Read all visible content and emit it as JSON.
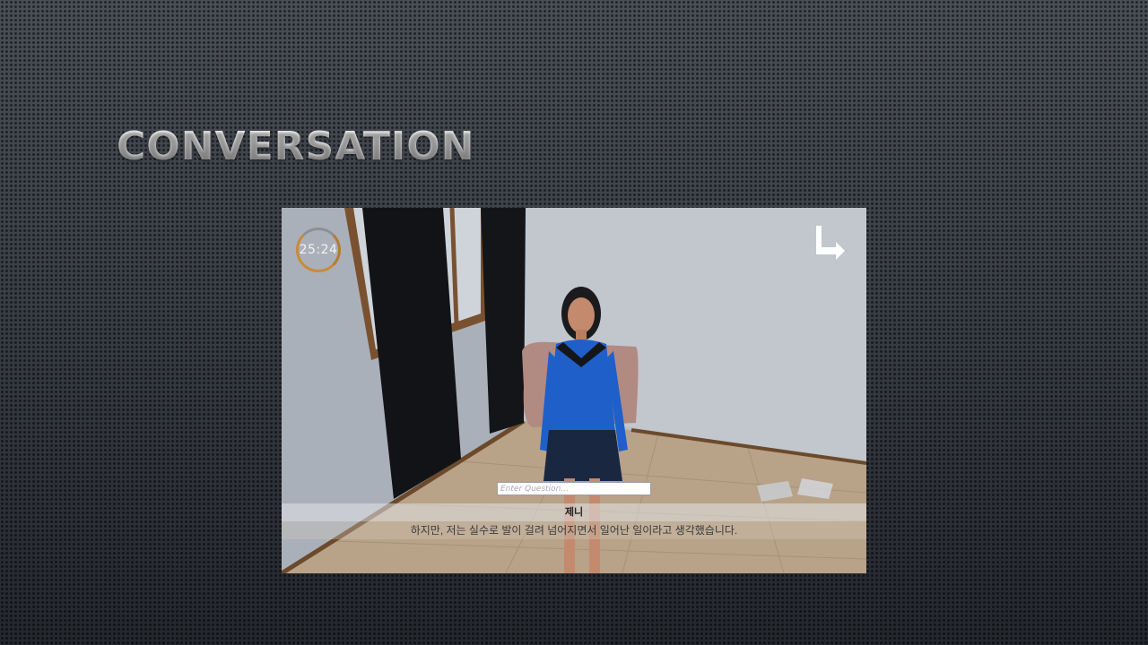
{
  "slide": {
    "title": "CONVERSATION"
  },
  "game": {
    "timer": "25:24",
    "exit_icon": "exit-arrow-icon",
    "question_placeholder": "Enter Question...",
    "speaker_name": "제니",
    "dialogue": "하지만, 저는 실수로 발이 걸려 넘어지면서 일어난 일이라고 생각했습니다.",
    "colors": {
      "timer_ring": "#c98a3a",
      "character_top": "#1f5fc9",
      "character_skirt": "#1a2740"
    }
  }
}
